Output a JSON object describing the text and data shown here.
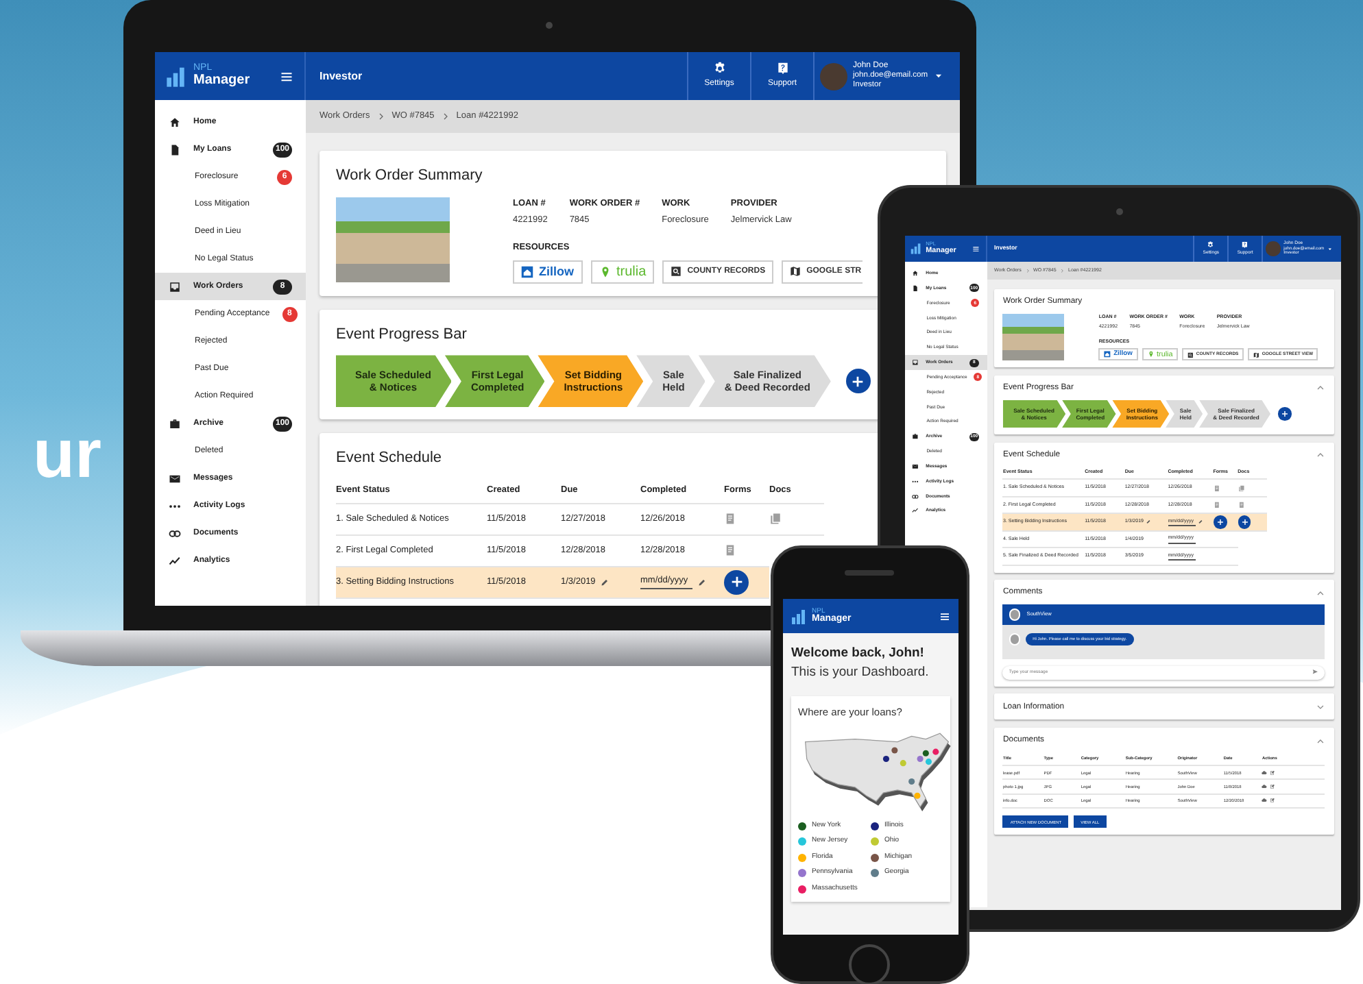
{
  "background_headline": "ur",
  "laptop": {
    "app": {
      "header": {
        "logo_small": "NPL",
        "logo_large": "Manager",
        "title": "Investor",
        "actions": [
          {
            "label": "Settings",
            "kind": "gear"
          },
          {
            "label": "Support",
            "kind": "help"
          }
        ],
        "user": {
          "name": "John Doe",
          "email": "john.doe@email.com",
          "role": "Investor"
        }
      },
      "sidebar": [
        {
          "label": "Home",
          "selected": false
        },
        {
          "label": "My Loans",
          "badge": "100",
          "alert": false,
          "selected": false,
          "children": [
            {
              "label": "Foreclosure",
              "badge": "6",
              "alert": true,
              "selected": false
            },
            {
              "label": "Loss Mitigation",
              "selected": false
            },
            {
              "label": "Deed in Lieu",
              "selected": false
            },
            {
              "label": "No Legal Status",
              "selected": false
            }
          ]
        },
        {
          "label": "Work Orders",
          "badge": "8",
          "alert": false,
          "selected": true,
          "children": [
            {
              "label": "Pending Acceptance",
              "badge": "8",
              "alert": true,
              "selected": false
            },
            {
              "label": "Rejected",
              "selected": false
            },
            {
              "label": "Past Due",
              "selected": false
            },
            {
              "label": "Action Required",
              "selected": false
            }
          ]
        },
        {
          "label": "Archive",
          "badge": "100",
          "alert": false,
          "selected": false,
          "children": [
            {
              "label": "Deleted",
              "selected": false
            }
          ]
        },
        {
          "label": "Messages",
          "selected": false
        },
        {
          "label": "Activity Logs",
          "selected": false
        },
        {
          "label": "Documents",
          "selected": false
        },
        {
          "label": "Analytics",
          "selected": false
        }
      ],
      "breadcrumb": [
        "Work Orders",
        "WO #7845",
        "Loan #4221992"
      ],
      "cards": [
        {
          "kind": "summary",
          "title": "Work Order Summary",
          "fields": [
            {
              "label": "LOAN #",
              "value": "4221992"
            },
            {
              "label": "WORK ORDER #",
              "value": "7845"
            },
            {
              "label": "WORK",
              "value": "Foreclosure"
            },
            {
              "label": "PROVIDER",
              "value": "Jelmervick Law"
            }
          ],
          "resources_label": "RESOURCES",
          "resources": [
            {
              "label": "Zillow",
              "kind": "house-logo"
            },
            {
              "label": "trulia",
              "kind": "pin-logo"
            },
            {
              "label": "COUNTY RECORDS",
              "kind": "search"
            },
            {
              "label": "GOOGLE STR",
              "kind": "map"
            }
          ]
        },
        {
          "kind": "progress",
          "title": "Event Progress Bar",
          "steps": [
            {
              "label": "Sale Scheduled\n& Notices",
              "kind": "done"
            },
            {
              "label": "First Legal\nCompleted",
              "kind": "done"
            },
            {
              "label": "Set Bidding\nInstructions",
              "kind": "current"
            },
            {
              "label": "Sale\nHeld",
              "kind": "pending"
            },
            {
              "label": "Sale Finalized\n& Deed Recorded",
              "kind": "pending"
            }
          ]
        },
        {
          "kind": "schedule",
          "title": "Event Schedule",
          "columns": [
            "Event Status",
            "Created",
            "Due",
            "Completed",
            "Forms",
            "Docs"
          ],
          "rows": [
            {
              "event": "1. Sale Scheduled & Notices",
              "created": "11/5/2018",
              "due": "12/27/2018",
              "completed": "12/26/2018",
              "forms": {
                "kind": "document"
              },
              "docs": {
                "kind": "copies"
              },
              "selected": false
            },
            {
              "event": "2. First Legal Completed",
              "created": "11/5/2018",
              "due": "12/28/2018",
              "completed": "12/28/2018",
              "forms": {
                "kind": "document"
              },
              "selected": false
            },
            {
              "event": "3. Setting Bidding Instructions",
              "created": "11/5/2018",
              "due": "1/3/2019",
              "due_editable": true,
              "completed_placeholder": "mm/dd/yyyy",
              "completed_editable": true,
              "forms": {
                "kind": "add"
              },
              "selected": true
            }
          ]
        }
      ]
    }
  },
  "tablet": {
    "app": {
      "header": {
        "logo_small": "NPL",
        "logo_large": "Manager",
        "title": "Investor",
        "actions": [
          {
            "label": "Settings",
            "kind": "gear"
          },
          {
            "label": "Support",
            "kind": "help"
          }
        ],
        "user": {
          "name": "John Doe",
          "email": "john.doe@email.com",
          "role": "Investor"
        }
      },
      "sidebar": [
        {
          "label": "Home",
          "selected": false
        },
        {
          "label": "My Loans",
          "badge": "100",
          "alert": false,
          "selected": false,
          "children": [
            {
              "label": "Foreclosure",
              "badge": "6",
              "alert": true,
              "selected": false
            },
            {
              "label": "Loss Mitigation",
              "selected": false
            },
            {
              "label": "Deed in Lieu",
              "selected": false
            },
            {
              "label": "No Legal Status",
              "selected": false
            }
          ]
        },
        {
          "label": "Work Orders",
          "badge": "8",
          "alert": false,
          "selected": true,
          "children": [
            {
              "label": "Pending Acceptance",
              "badge": "8",
              "alert": true,
              "selected": false
            },
            {
              "label": "Rejected",
              "selected": false
            },
            {
              "label": "Past Due",
              "selected": false
            },
            {
              "label": "Action Required",
              "selected": false
            }
          ]
        },
        {
          "label": "Archive",
          "badge": "100",
          "alert": false,
          "selected": false,
          "children": [
            {
              "label": "Deleted",
              "selected": false
            }
          ]
        },
        {
          "label": "Messages",
          "selected": false
        },
        {
          "label": "Activity Logs",
          "selected": false
        },
        {
          "label": "Documents",
          "selected": false
        },
        {
          "label": "Analytics",
          "selected": false
        }
      ],
      "breadcrumb": [
        "Work Orders",
        "WO #7845",
        "Loan #4221992"
      ],
      "cards": [
        {
          "kind": "summary",
          "title": "Work Order Summary",
          "fields": [
            {
              "label": "LOAN #",
              "value": "4221992"
            },
            {
              "label": "WORK ORDER #",
              "value": "7845"
            },
            {
              "label": "WORK",
              "value": "Foreclosure"
            },
            {
              "label": "PROVIDER",
              "value": "Jelmervick Law"
            }
          ],
          "resources_label": "RESOURCES",
          "resources": [
            {
              "label": "Zillow",
              "kind": "house-logo"
            },
            {
              "label": "trulia",
              "kind": "pin-logo"
            },
            {
              "label": "COUNTY RECORDS",
              "kind": "search"
            },
            {
              "label": "GOOGLE STREET VIEW",
              "kind": "map"
            }
          ]
        },
        {
          "kind": "progress",
          "title": "Event Progress Bar",
          "expanded": true,
          "steps": [
            {
              "label": "Sale Scheduled\n& Notices",
              "kind": "done"
            },
            {
              "label": "First Legal\nCompleted",
              "kind": "done"
            },
            {
              "label": "Set Bidding\nInstructions",
              "kind": "current"
            },
            {
              "label": "Sale\nHeld",
              "kind": "pending"
            },
            {
              "label": "Sale Finalized\n& Deed Recorded",
              "kind": "pending"
            }
          ]
        },
        {
          "kind": "schedule",
          "title": "Event Schedule",
          "expanded": true,
          "columns": [
            "Event Status",
            "Created",
            "Due",
            "Completed",
            "Forms",
            "Docs"
          ],
          "rows": [
            {
              "event": "1. Sale Scheduled & Notices",
              "created": "11/5/2018",
              "due": "12/27/2018",
              "completed": "12/26/2018",
              "forms": {
                "kind": "document"
              },
              "docs": {
                "kind": "copies"
              },
              "selected": false
            },
            {
              "event": "2. First Legal Completed",
              "created": "11/5/2018",
              "due": "12/28/2018",
              "completed": "12/28/2018",
              "forms": {
                "kind": "document"
              },
              "docs": {
                "kind": "document"
              },
              "selected": false
            },
            {
              "event": "3. Setting Bidding Instructions",
              "created": "11/5/2018",
              "due": "1/3/2019",
              "due_editable": true,
              "completed_placeholder": "mm/dd/yyyy",
              "completed_editable": true,
              "forms": {
                "kind": "add"
              },
              "docs": {
                "kind": "add"
              },
              "selected": true
            },
            {
              "event": "4. Sale Held",
              "created": "11/5/2018",
              "due": "1/4/2019",
              "completed_placeholder": "mm/dd/yyyy",
              "selected": false
            },
            {
              "event": "5. Sale Finalized & Deed Recorded",
              "created": "11/5/2018",
              "due": "3/5/2019",
              "completed_placeholder": "mm/dd/yyyy",
              "selected": false
            }
          ]
        },
        {
          "kind": "comments",
          "title": "Comments",
          "expanded": true,
          "thread_name": "SouthView",
          "messages": [
            "Hi John. Please call me to discuss your bid strategy."
          ],
          "placeholder": "Type your message"
        },
        {
          "kind": "section",
          "title": "Loan Information",
          "expanded": false
        },
        {
          "kind": "documents",
          "title": "Documents",
          "expanded": true,
          "columns": [
            "Title",
            "Type",
            "Category",
            "Sub-Category",
            "Originator",
            "Date",
            "Actions"
          ],
          "rows": [
            [
              "lease.pdf",
              "PDF",
              "Legal",
              "Hearing",
              "SouthView",
              "11/5/2018"
            ],
            [
              "photo 1.jpg",
              "JPG",
              "Legal",
              "Hearing",
              "John Doe",
              "11/8/2018"
            ],
            [
              "info.doc",
              "DOC",
              "Legal",
              "Hearing",
              "SouthView",
              "12/20/2018"
            ]
          ],
          "buttons": [
            "ATTACH NEW DOCUMENT",
            "VIEW ALL"
          ]
        }
      ]
    }
  },
  "phone": {
    "logo_small": "NPL",
    "logo_large": "Manager",
    "welcome": "Welcome back, John!",
    "subtitle": "This is your Dashboard.",
    "card_title": "Where are your loans?",
    "legend": [
      {
        "label": "New York",
        "color": "#1b5e20"
      },
      {
        "label": "Illinois",
        "color": "#1a237e"
      },
      {
        "label": "New Jersey",
        "color": "#26c6da"
      },
      {
        "label": "Ohio",
        "color": "#c0ca33"
      },
      {
        "label": "Florida",
        "color": "#ffb300"
      },
      {
        "label": "Michigan",
        "color": "#795548"
      },
      {
        "label": "Pennsylvania",
        "color": "#9575cd"
      },
      {
        "label": "Georgia",
        "color": "#607d8b"
      },
      {
        "label": "Massachusetts",
        "color": "#e91e63"
      }
    ]
  }
}
